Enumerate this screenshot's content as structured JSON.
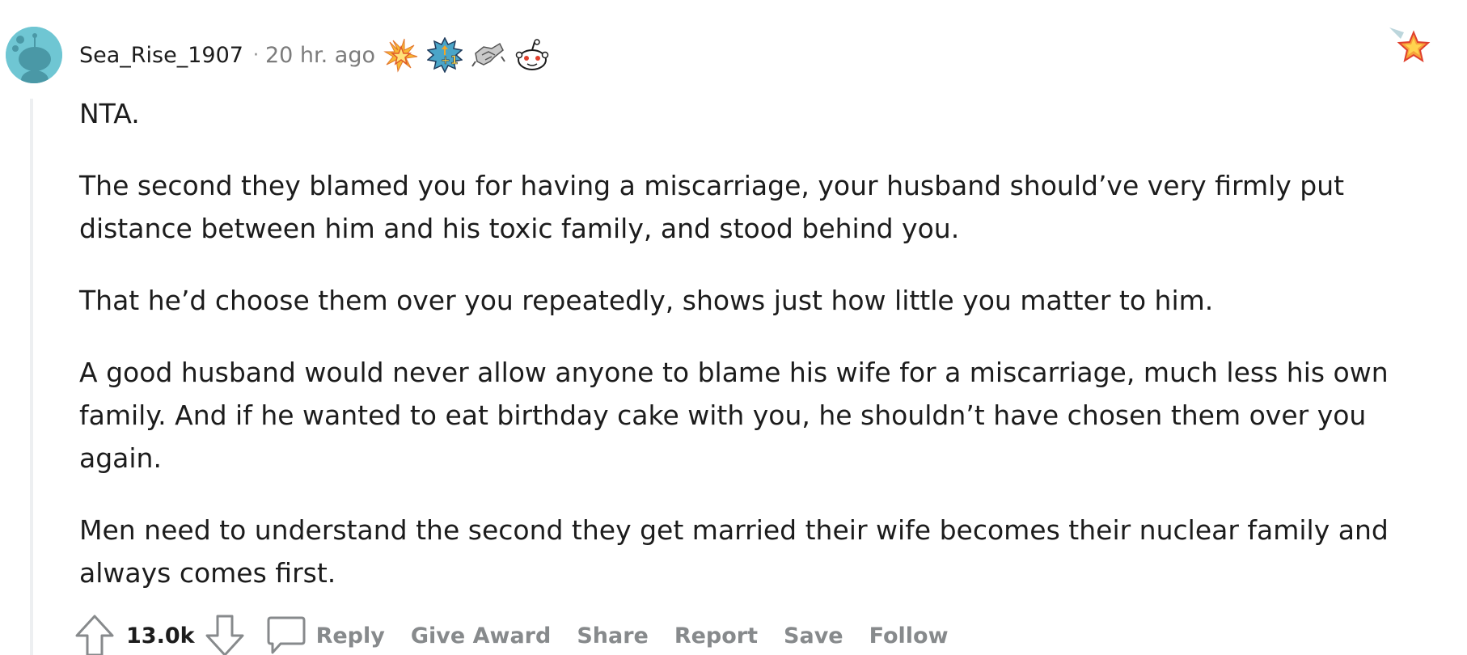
{
  "comment": {
    "author": "Sea_Rise_1907",
    "separator": "·",
    "timestamp": "20 hr. ago",
    "awards": [
      "star-burst-award-icon",
      "take-my-upvote-award-icon",
      "handshake-award-icon",
      "snoo-eyes-award-icon"
    ],
    "corner_award": "star-award-icon",
    "paragraphs": [
      "NTA.",
      "The second they blamed you for having a miscarriage, your husband should’ve very firmly put distance between him and his toxic family, and stood behind you.",
      "That he’d choose them over you repeatedly, shows just how little you matter to him.",
      "A good husband would never allow anyone to blame his wife for a miscarriage, much less his own family. And if he wanted to eat birthday cake with you, he shouldn’t have chosen them over you again.",
      "Men need to understand the second they get married their wife becomes their nuclear family and always comes first."
    ],
    "score": "13.0k",
    "actions": {
      "reply": "Reply",
      "give_award": "Give Award",
      "share": "Share",
      "report": "Report",
      "save": "Save",
      "follow": "Follow"
    },
    "colors": {
      "avatar": "#6fc6d3",
      "text": "#1c1c1c",
      "muted": "#878a8c",
      "thread_line": "#edeff1"
    }
  }
}
